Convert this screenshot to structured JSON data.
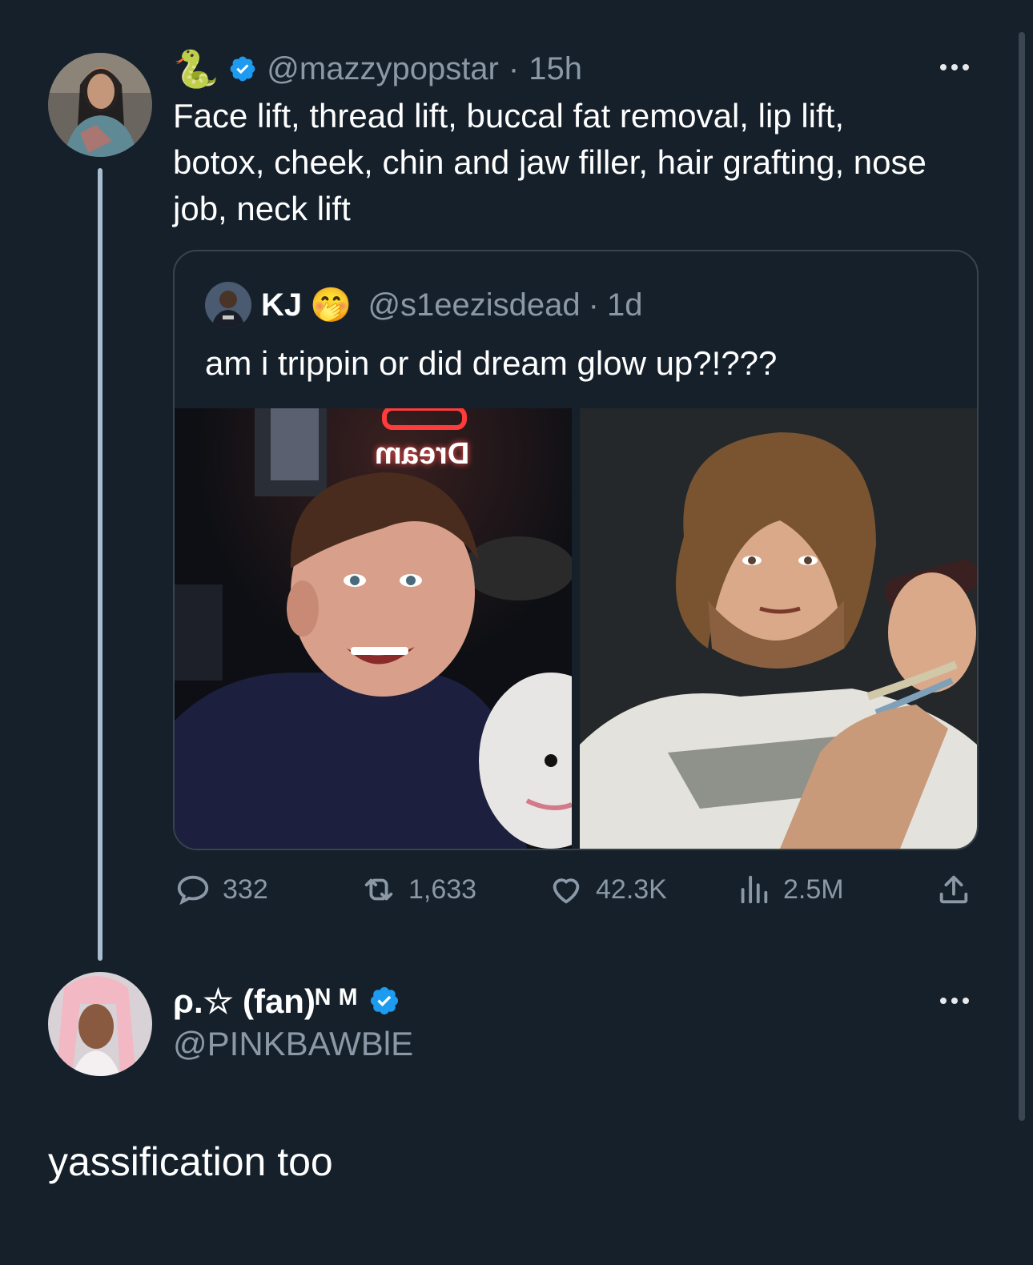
{
  "tweet": {
    "emoji": "🐍",
    "handle": "@mazzypopstar",
    "sep": "·",
    "time": "15h",
    "text": "Face lift, thread lift, buccal fat removal, lip lift, botox, cheek, chin and jaw filler, hair grafting, nose job, neck lift",
    "quote": {
      "name": "KJ",
      "name_emoji": "🤭",
      "handle": "@s1eezisdead",
      "sep": "·",
      "time": "1d",
      "text": "am i trippin or did dream glow up?!???",
      "images": [
        {
          "sign": "Dream",
          "alt": "young man with curly hair in front of a Dream neon sign"
        },
        {
          "alt": "bearded man with long curly hair holding a microphone"
        }
      ]
    },
    "stats": {
      "replies": "332",
      "reposts": "1,633",
      "likes": "42.3K",
      "views": "2.5M"
    }
  },
  "reply": {
    "name": "ρ.☆ (fan)ᴺ ᴹ",
    "handle": "@PINKBAWBlE",
    "text": "yassification too"
  },
  "colors": {
    "background": "#15202b",
    "muted": "#8b98a5",
    "verified": "#1d9bf0",
    "thread_line": "#a9bdcf"
  }
}
